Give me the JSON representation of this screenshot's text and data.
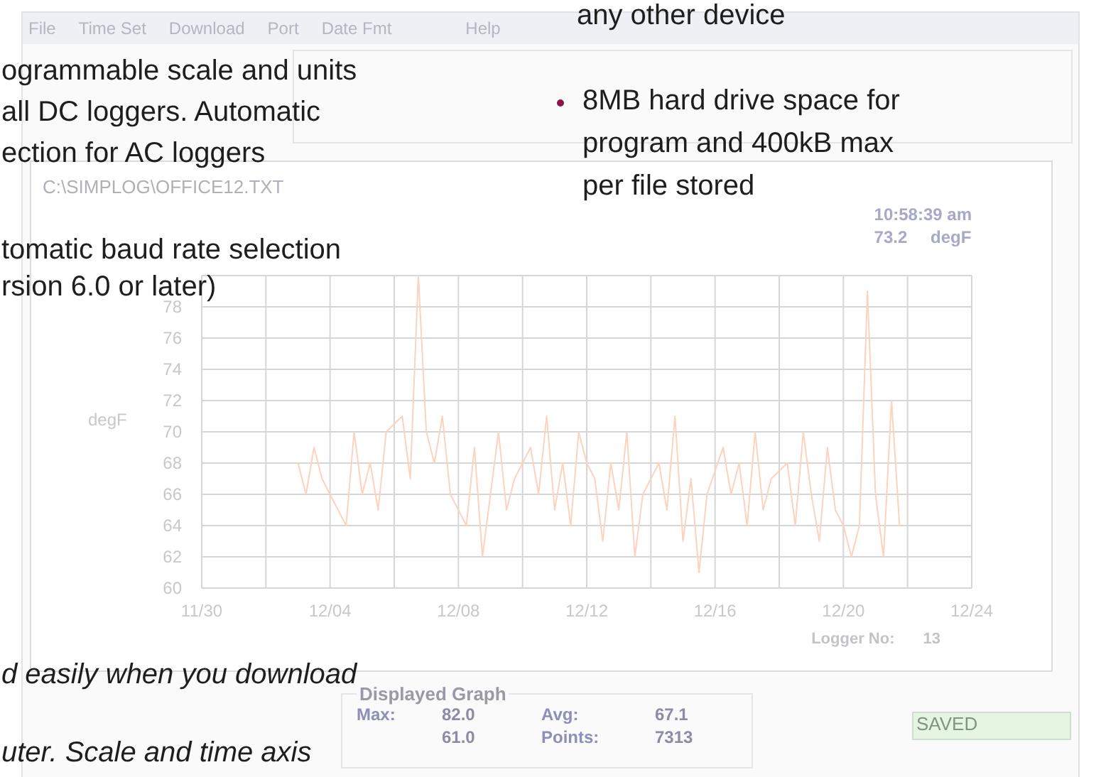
{
  "menu": [
    "File",
    "Time Set",
    "Download",
    "Port",
    "Date Fmt",
    "Help"
  ],
  "overlay_notes": [
    {
      "kind": "plain",
      "lines": [
        "any other device"
      ]
    },
    {
      "kind": "plain",
      "lines": [
        "ogrammable scale and units",
        "all DC loggers. Automatic",
        "ection for AC loggers"
      ]
    },
    {
      "kind": "bullet",
      "lines": [
        "8MB hard drive space for",
        "program and 400kB max",
        "per file stored"
      ]
    },
    {
      "kind": "plain",
      "lines": [
        "tomatic baud rate selection",
        "rsion 6.0 or later)"
      ]
    },
    {
      "kind": "italic",
      "lines": [
        "d easily when you download"
      ]
    },
    {
      "kind": "italic",
      "lines": [
        "uter. Scale and time axis"
      ]
    }
  ],
  "file_path": "C:\\SIMPLOG\\OFFICE12.TXT",
  "readout": {
    "time": "10:58:39 am",
    "value": "73.2",
    "unit": "degF"
  },
  "chart": {
    "chart_data": {
      "type": "line",
      "ylabel": "degF",
      "categories": [
        "11/30",
        null,
        null,
        null,
        null,
        null,
        null,
        null,
        null,
        null,
        null,
        null,
        null,
        null,
        null,
        null,
        "12/04",
        null,
        null,
        null,
        null,
        null,
        null,
        null,
        null,
        null,
        null,
        null,
        null,
        null,
        null,
        null,
        "12/08",
        null,
        null,
        null,
        null,
        null,
        null,
        null,
        null,
        null,
        null,
        null,
        null,
        null,
        null,
        null,
        "12/12",
        null,
        null,
        null,
        null,
        null,
        null,
        null,
        null,
        null,
        null,
        null,
        null,
        null,
        null,
        null,
        "12/16",
        null,
        null,
        null,
        null,
        null,
        null,
        null,
        null,
        null,
        null,
        null,
        null,
        null,
        null,
        null,
        "12/20",
        null,
        null,
        null,
        null,
        null,
        null,
        null,
        null,
        null,
        null,
        null,
        null,
        null,
        null,
        null,
        "12/24"
      ],
      "series": [
        {
          "color": "#fbd3bf",
          "values": [
            null,
            null,
            null,
            null,
            null,
            null,
            null,
            null,
            null,
            null,
            null,
            null,
            68,
            66,
            69,
            67,
            66,
            65,
            64,
            70,
            66,
            68,
            65,
            70,
            70.5,
            71,
            67,
            80,
            70,
            68,
            71,
            66,
            65,
            64,
            69,
            62,
            66,
            70,
            65,
            67,
            68,
            69,
            66,
            71,
            65,
            68,
            64,
            70,
            68,
            67,
            63,
            68,
            65,
            70,
            62,
            66,
            67,
            68,
            65,
            71,
            63,
            67,
            61,
            66,
            67.5,
            69,
            66,
            68,
            64,
            70,
            65,
            67,
            67.5,
            68,
            64,
            70,
            66,
            63,
            69,
            65,
            64,
            62,
            64,
            79,
            66,
            62,
            72,
            64,
            null,
            null,
            null,
            null,
            null,
            null,
            null,
            null,
            null
          ]
        }
      ],
      "ylim": [
        60,
        80
      ],
      "grid": true,
      "yticks": [
        60,
        62,
        64,
        66,
        68,
        70,
        72,
        74,
        76,
        78
      ]
    }
  },
  "logger": {
    "label": "Logger No:",
    "value": "13"
  },
  "displayed_graph": {
    "title": "Displayed Graph",
    "stats": [
      {
        "label": "Max:",
        "value": "82.0"
      },
      {
        "label": "Avg:",
        "value": "67.1"
      },
      {
        "value": "61.0"
      },
      {
        "label": "Points:",
        "value": "7313"
      }
    ]
  },
  "status": "SAVED"
}
